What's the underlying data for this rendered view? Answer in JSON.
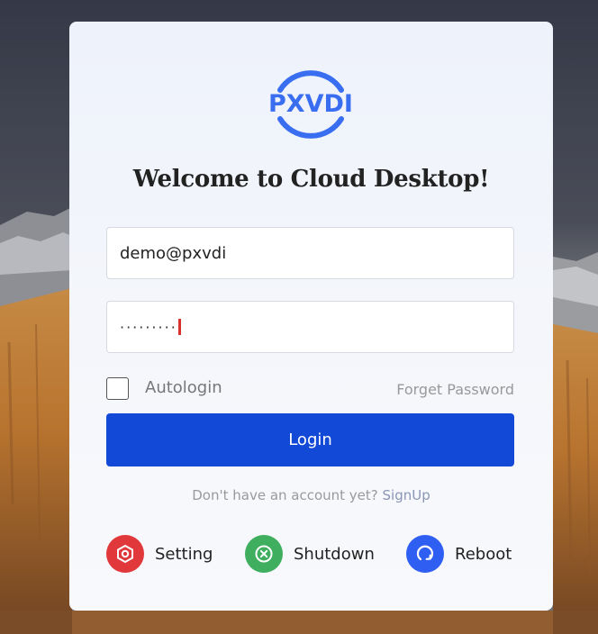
{
  "brand": {
    "logo_text": "PXVDI",
    "logo_icon": "pxvdi-logo",
    "accent_color": "#3a6ef0"
  },
  "welcome_title": "Welcome to Cloud Desktop!",
  "form": {
    "email_value": "demo@pxvdi",
    "password_masked": "·········"
  },
  "options": {
    "autologin_label": "Autologin",
    "autologin_checked": false,
    "forget_password_label": "Forget Password"
  },
  "login_button_label": "Login",
  "signup": {
    "prompt": "Don't have an account yet? ",
    "link_label": "SignUp"
  },
  "actions": [
    {
      "label": "Setting",
      "icon": "setting-icon",
      "color": "#e0383b"
    },
    {
      "label": "Shutdown",
      "icon": "shutdown-icon",
      "color": "#3fae5f"
    },
    {
      "label": "Reboot",
      "icon": "reboot-icon",
      "color": "#2f5ff2"
    }
  ]
}
